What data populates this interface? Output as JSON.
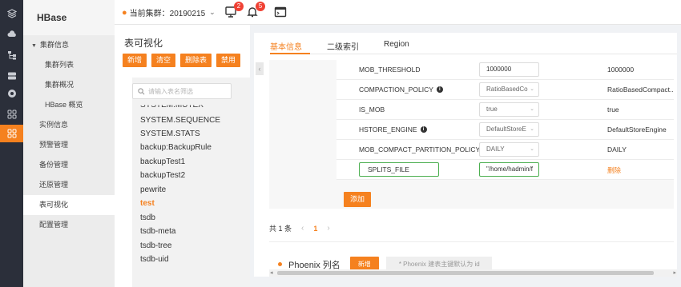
{
  "nav": {
    "brand": "HBase",
    "items": [
      {
        "label": "集群信息",
        "kind": "group"
      },
      {
        "label": "集群列表",
        "kind": "l2"
      },
      {
        "label": "集群概况",
        "kind": "l2"
      },
      {
        "label": "HBase 概览",
        "kind": "l2"
      },
      {
        "label": "实例信息",
        "kind": "l1"
      },
      {
        "label": "预警管理",
        "kind": "l1"
      },
      {
        "label": "备份管理",
        "kind": "l1"
      },
      {
        "label": "还原管理",
        "kind": "l1"
      },
      {
        "label": "表可视化",
        "kind": "l1",
        "active": true
      },
      {
        "label": "配置管理",
        "kind": "l1"
      }
    ]
  },
  "header": {
    "cluster_label": "当前集群：20190215",
    "monitor_badge": "2",
    "bell_badge": "5"
  },
  "tables_panel": {
    "title": "表可视化",
    "buttons": [
      "新增",
      "清空",
      "删除表",
      "禁用"
    ],
    "search_placeholder": "请输入表名筛选",
    "clipped_item": "SYSTEM.MUTEX",
    "tables": [
      "SYSTEM.SEQUENCE",
      "SYSTEM.STATS",
      "backup:BackupRule",
      "backupTest1",
      "backupTest2",
      "pewrite",
      "test",
      "tsdb",
      "tsdb-meta",
      "tsdb-tree",
      "tsdb-uid"
    ],
    "selected": "test"
  },
  "detail": {
    "tabs": [
      "基本信息",
      "二级索引",
      "Region"
    ],
    "active_tab": "基本信息",
    "rows": [
      {
        "name": "MOB_THRESHOLD",
        "info": false,
        "value": "1000000",
        "type": "input",
        "default": "1000000"
      },
      {
        "name": "COMPACTION_POLICY",
        "info": true,
        "value": "RatioBasedCo",
        "type": "select",
        "default": "RatioBasedCompact..."
      },
      {
        "name": "IS_MOB",
        "info": false,
        "value": "true",
        "type": "select",
        "default": "true"
      },
      {
        "name": "HSTORE_ENGINE",
        "info": true,
        "value": "DefaultStoreE",
        "type": "select",
        "default": "DefaultStoreEngine"
      },
      {
        "name": "MOB_COMPACT_PARTITION_POLICY",
        "info": false,
        "value": "DAILY",
        "type": "select",
        "default": "DAILY"
      }
    ],
    "custom_row": {
      "key": "SPLITS_FILE",
      "value": "\"/home/hadmin/f",
      "action": "删除"
    },
    "add_label": "添加",
    "pager": {
      "total": "共 1 条",
      "prev": "‹",
      "page": "1",
      "next": "›"
    },
    "phoenix": {
      "title": "Phoenix 列名",
      "new_label": "新增",
      "hint": "* Phoenix 建表主键默认为 id"
    }
  }
}
